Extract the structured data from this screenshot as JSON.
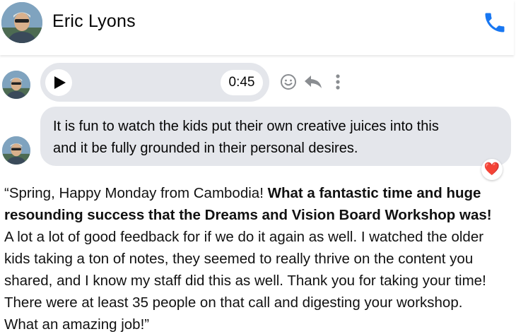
{
  "header": {
    "contact_name": "Eric Lyons",
    "call_icon": "phone-icon",
    "accent_color": "#1877f2"
  },
  "audio_message": {
    "play_icon": "play-icon",
    "duration": "0:45"
  },
  "message_actions": [
    {
      "icon": "smiley-icon"
    },
    {
      "icon": "reply-icon"
    },
    {
      "icon": "more-vertical-icon"
    }
  ],
  "text_message": {
    "line1": "It is fun to watch the kids put their own creative juices into this",
    "line2": "and it be fully grounded in their personal desires.",
    "reaction": "❤️"
  },
  "testimonial": {
    "line1_normal": "“Spring, Happy Monday from Cambodia! ",
    "line1_bold": "What a fantastic time and huge",
    "line2_bold": "resounding success that the Dreams and Vision Board Workshop was!",
    "line3": "A lot a lot of good feedback for if we do it again as well. I watched the older",
    "line4": "kids taking a ton of notes, they seemed to really thrive on the content you",
    "line5": "shared, and I know my staff did this as well. Thank you for taking your time!",
    "line6": "There were at least 35 people on that call and digesting your workshop.",
    "line7": "What an amazing job!”"
  }
}
